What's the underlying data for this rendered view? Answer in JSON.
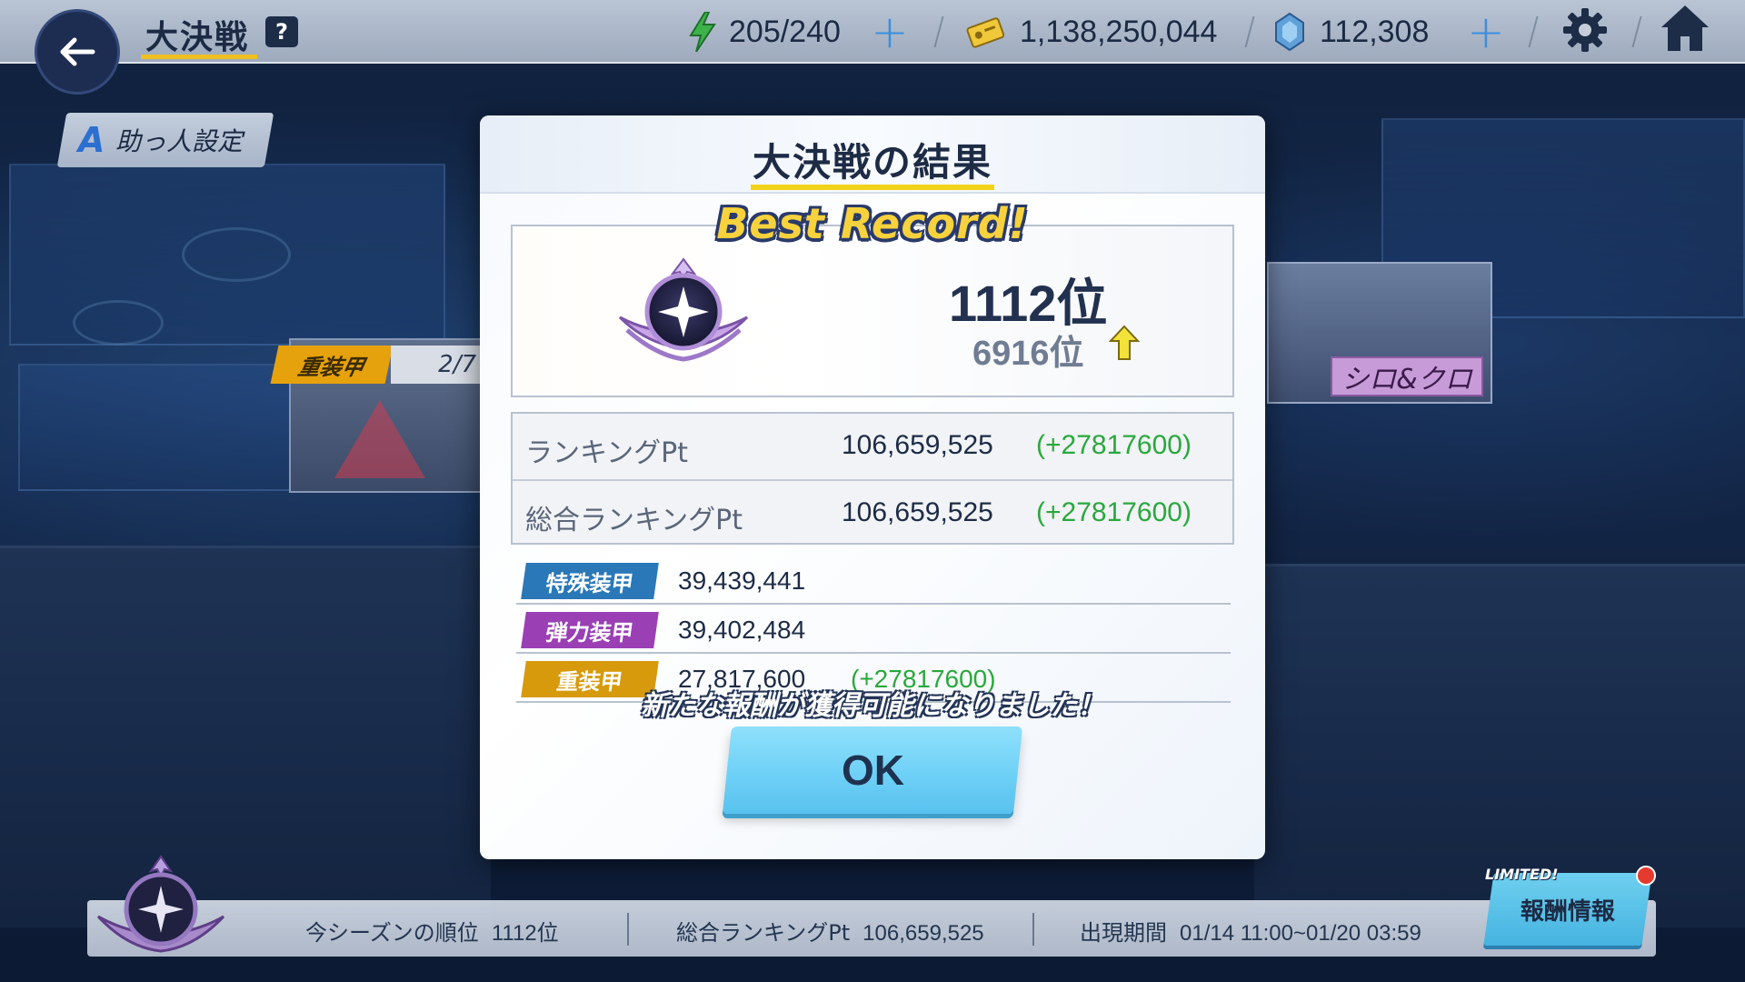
{
  "header": {
    "title": "大決戦",
    "help_label": "?",
    "stamina": "205/240",
    "credits": "1,138,250,044",
    "gems": "112,308"
  },
  "helper_setting": {
    "icon_letter": "A",
    "label": "助っ人設定"
  },
  "side_left": {
    "armor_tag": "重装甲",
    "count": "2/7"
  },
  "side_right": {
    "name": "シロ&クロ"
  },
  "result_modal": {
    "title": "大決戦の結果",
    "best_record": "Best Record!",
    "rank_current": "1112位",
    "rank_previous": "6916位",
    "ranking_pt_label": "ランキングPt",
    "ranking_pt_value": "106,659,525",
    "ranking_pt_diff": "(+27817600)",
    "total_pt_label": "総合ランキングPt",
    "total_pt_value": "106,659,525",
    "total_pt_diff": "(+27817600)",
    "armors": [
      {
        "label": "特殊装甲",
        "value": "39,439,441",
        "diff": "",
        "color": "#2a78b8"
      },
      {
        "label": "弾力装甲",
        "value": "39,402,484",
        "diff": "",
        "color": "#9a3fb4"
      },
      {
        "label": "重装甲",
        "value": "27,817,600",
        "diff": "(+27817600)",
        "color": "#d69a0c"
      }
    ],
    "notice": "新たな報酬が獲得可能になりました！",
    "ok_label": "OK"
  },
  "footer": {
    "season_rank_label": "今シーズンの順位",
    "season_rank_value": "1112位",
    "total_pt_label": "総合ランキングPt",
    "total_pt_value": "106,659,525",
    "period_label": "出現期間",
    "period_value": "01/14 11:00~01/20 03:59",
    "limited_badge": "LIMITED!",
    "reward_button": "報酬情報"
  },
  "colors": {
    "accent_yellow": "#f2d21a",
    "diff_green": "#2aa83d",
    "ok_button": "#6ccff6"
  }
}
